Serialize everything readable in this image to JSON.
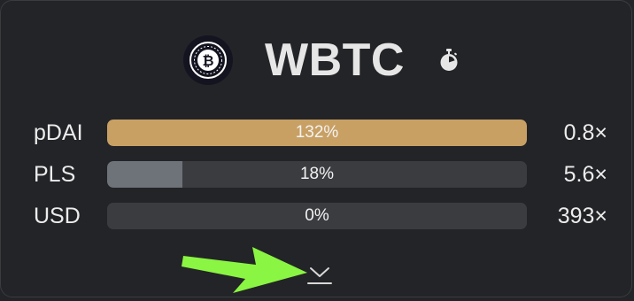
{
  "token": {
    "name": "WBTC",
    "logo_icon": "bitcoin-icon",
    "timer_icon": "stopwatch-icon"
  },
  "rows": [
    {
      "label": "pDAI",
      "percent_text": "132%",
      "fill_fraction": 1.0,
      "fill_color": "#c8a064",
      "multiplier": "0.8×"
    },
    {
      "label": "PLS",
      "percent_text": "18%",
      "fill_fraction": 0.18,
      "fill_color": "#6e737a",
      "multiplier": "5.6×"
    },
    {
      "label": "USD",
      "percent_text": "0%",
      "fill_fraction": 0.0,
      "fill_color": "#6e737a",
      "multiplier": "393×"
    }
  ],
  "expand": {
    "icon": "chevron-down-icon"
  },
  "annotation": {
    "icon": "green-arrow-icon",
    "color": "#8af542"
  },
  "colors": {
    "background": "#232427",
    "track": "#3a3c40",
    "pdai_fill": "#c8a064",
    "pls_fill": "#6e737a"
  }
}
